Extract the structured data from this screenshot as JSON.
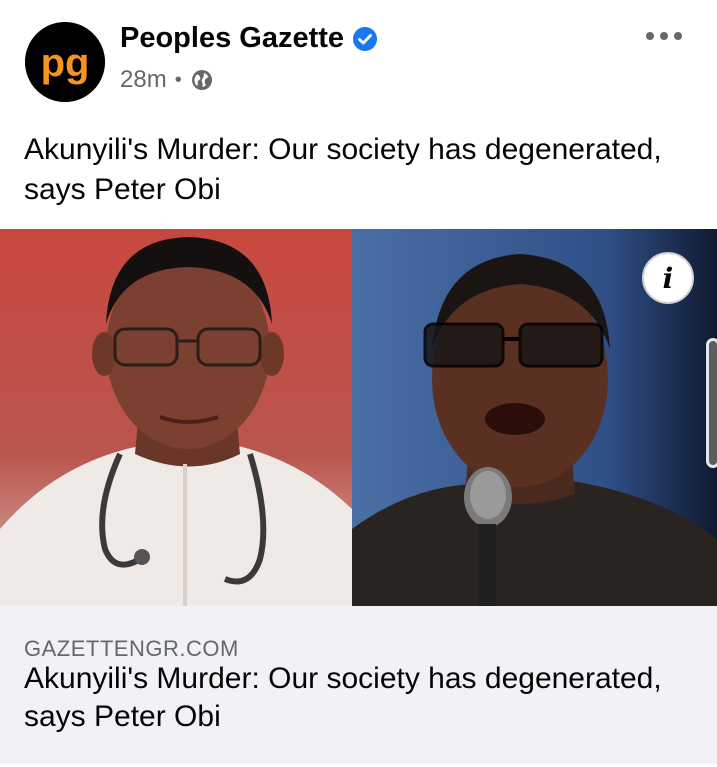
{
  "post": {
    "page_name": "Peoples Gazette",
    "timestamp": "28m",
    "separator": "•",
    "audience_icon": "globe-icon",
    "verified_icon": "verified-badge-icon",
    "more_icon": "more-options-icon",
    "caption": "Akunyili's Murder: Our society has degenerated, says Peter Obi",
    "avatar_logo_text": "pg"
  },
  "media": {
    "info_label": "i"
  },
  "link_preview": {
    "domain": "GAZETTENGR.COM",
    "title": "Akunyili's Murder: Our society has degenerated, says Peter Obi"
  },
  "colors": {
    "brand_orange": "#f7941d",
    "verified_blue": "#1877f2",
    "secondary_text": "#65676b",
    "preview_bg": "#f0f2f5"
  }
}
